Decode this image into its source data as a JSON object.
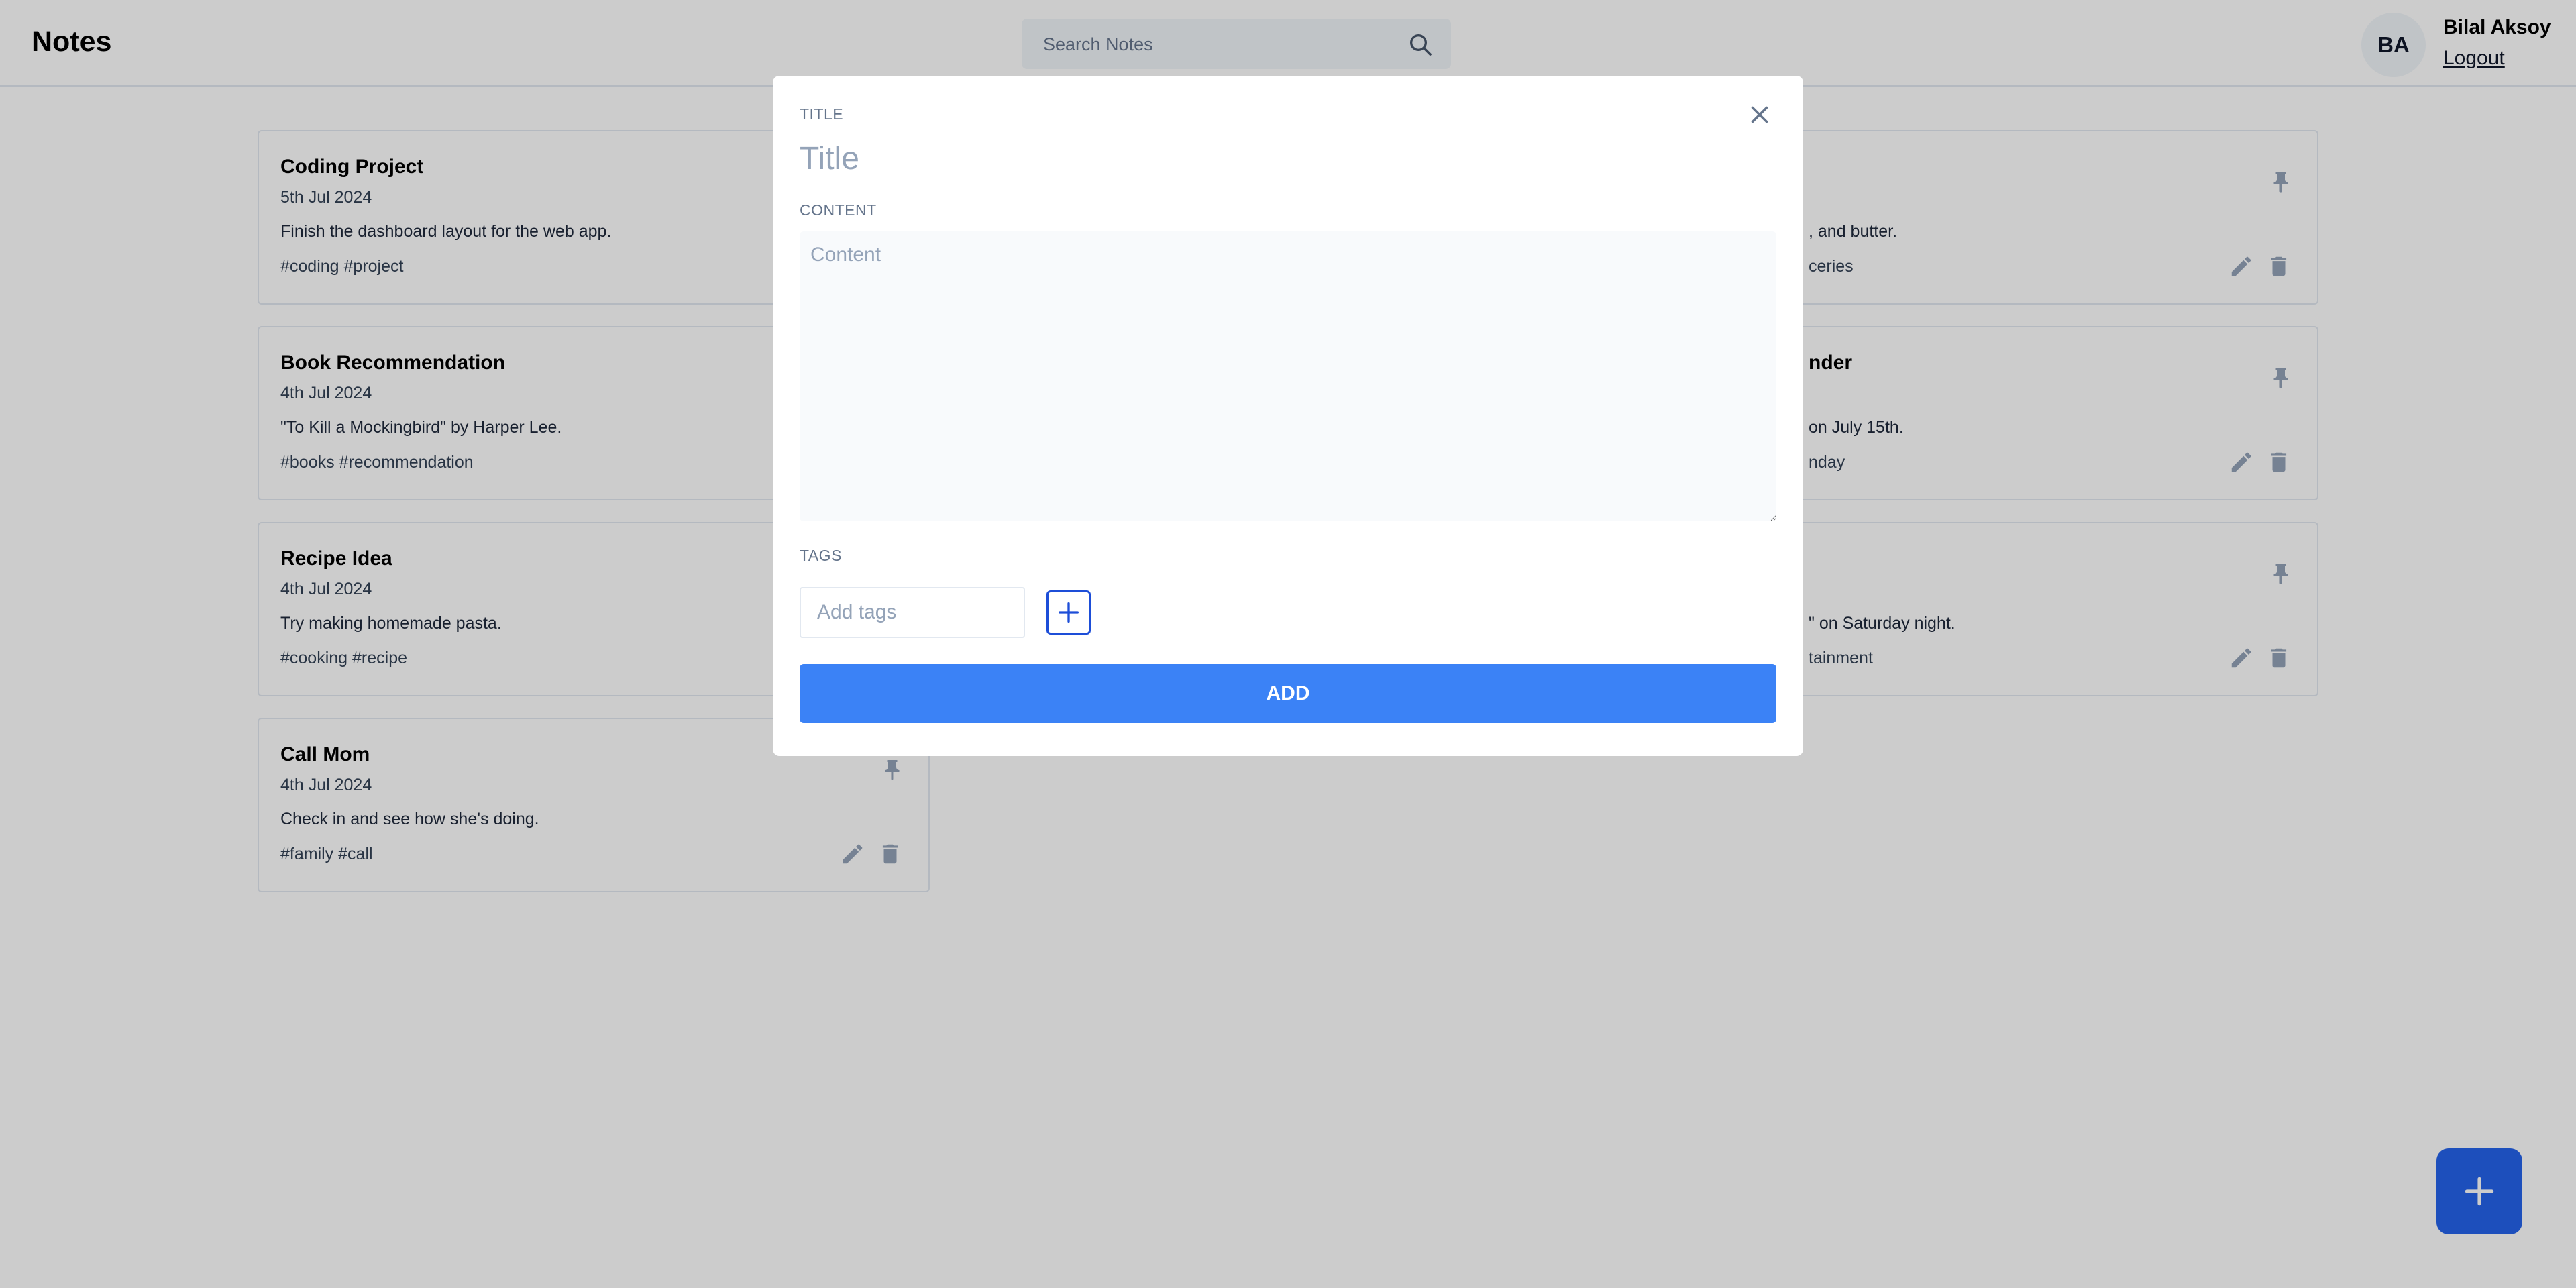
{
  "header": {
    "brand": "Notes",
    "search_placeholder": "Search Notes",
    "user_initials": "BA",
    "user_name": "Bilal Aksoy",
    "logout_label": "Logout"
  },
  "notes": [
    {
      "title": "Coding Project",
      "date": "5th Jul 2024",
      "content": "Finish the dashboard layout for the web app.",
      "tags": "#coding #project"
    },
    {
      "title": "Book Recommendation",
      "date": "4th Jul 2024",
      "content": "\"To Kill a Mockingbird\" by Harper Lee.",
      "tags": "#books #recommendation"
    },
    {
      "title": "Recipe Idea",
      "date": "4th Jul 2024",
      "content": "Try making homemade pasta.",
      "tags": "#cooking #recipe"
    },
    {
      "title": "Call Mom",
      "date": "4th Jul 2024",
      "content": "Check in and see how she's doing.",
      "tags": "#family #call"
    },
    {
      "title": "",
      "date": "",
      "content": ", and butter.",
      "tags": "ceries"
    },
    {
      "title": "nder",
      "date": "",
      "content": "on July 15th.",
      "tags": "nday"
    },
    {
      "title": "",
      "date": "",
      "content": "\" on Saturday night.",
      "tags": "tainment"
    }
  ],
  "modal": {
    "title_label": "TITLE",
    "title_placeholder": "Title",
    "content_label": "CONTENT",
    "content_placeholder": "Content",
    "tags_label": "TAGS",
    "tags_placeholder": "Add tags",
    "add_label": "ADD"
  },
  "colors": {
    "primary": "#3b82f6",
    "fab": "#2563eb",
    "icon_gray": "#94a3b8"
  }
}
